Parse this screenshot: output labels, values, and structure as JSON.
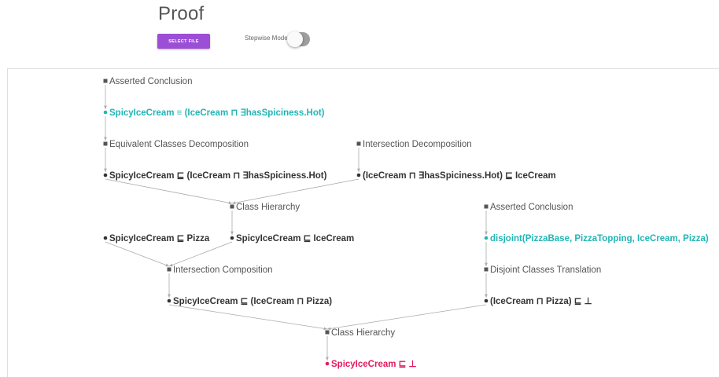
{
  "header": {
    "title": "Proof",
    "select_file_label": "SELECT FILE",
    "stepwise_label": "Stepwise Mode",
    "stepwise_on": false
  },
  "colors": {
    "accent": "#9c4fd6",
    "asserted": "#22b5b5",
    "conclusion": "#e6195e",
    "axiom": "#333333",
    "rule": "#555555",
    "edge": "#aaaaaa"
  },
  "proof": {
    "nodes": [
      {
        "id": "r1",
        "kind": "rule",
        "text": "Asserted Conclusion"
      },
      {
        "id": "a1",
        "kind": "asserted",
        "text": "SpicyIceCream ≡ (IceCream ⊓ ∃hasSpiciness.Hot)"
      },
      {
        "id": "r2",
        "kind": "rule",
        "text": "Equivalent Classes Decomposition"
      },
      {
        "id": "r3",
        "kind": "rule",
        "text": "Intersection Decomposition"
      },
      {
        "id": "a2",
        "kind": "axiom",
        "text": "SpicyIceCream ⊑ (IceCream ⊓ ∃hasSpiciness.Hot)"
      },
      {
        "id": "a3",
        "kind": "axiom",
        "text": "(IceCream ⊓ ∃hasSpiciness.Hot) ⊑ IceCream"
      },
      {
        "id": "r4",
        "kind": "rule",
        "text": "Class Hierarchy"
      },
      {
        "id": "r5",
        "kind": "rule",
        "text": "Asserted Conclusion"
      },
      {
        "id": "a4",
        "kind": "axiom",
        "text": "SpicyIceCream ⊑ Pizza"
      },
      {
        "id": "a5",
        "kind": "axiom",
        "text": "SpicyIceCream ⊑ IceCream"
      },
      {
        "id": "a6",
        "kind": "asserted",
        "text": "disjoint(PizzaBase, PizzaTopping, IceCream, Pizza)"
      },
      {
        "id": "r6",
        "kind": "rule",
        "text": "Intersection Composition"
      },
      {
        "id": "r7",
        "kind": "rule",
        "text": "Disjoint Classes Translation"
      },
      {
        "id": "a7",
        "kind": "axiom",
        "text": "SpicyIceCream ⊑ (IceCream ⊓ Pizza)"
      },
      {
        "id": "a8",
        "kind": "axiom",
        "text": "(IceCream ⊓ Pizza) ⊑ ⊥"
      },
      {
        "id": "r8",
        "kind": "rule",
        "text": "Class Hierarchy"
      },
      {
        "id": "a9",
        "kind": "conclusion",
        "text": "SpicyIceCream ⊑ ⊥"
      }
    ],
    "edges": [
      [
        "r1",
        "a1"
      ],
      [
        "a1",
        "r2"
      ],
      [
        "r2",
        "a2"
      ],
      [
        "r3",
        "a3"
      ],
      [
        "a2",
        "r4"
      ],
      [
        "a3",
        "r4"
      ],
      [
        "r4",
        "a5"
      ],
      [
        "r5",
        "a6"
      ],
      [
        "a6",
        "r7"
      ],
      [
        "r7",
        "a8"
      ],
      [
        "a4",
        "r6"
      ],
      [
        "a5",
        "r6"
      ],
      [
        "r6",
        "a7"
      ],
      [
        "a7",
        "r8"
      ],
      [
        "a8",
        "r8"
      ],
      [
        "r8",
        "a9"
      ]
    ]
  }
}
